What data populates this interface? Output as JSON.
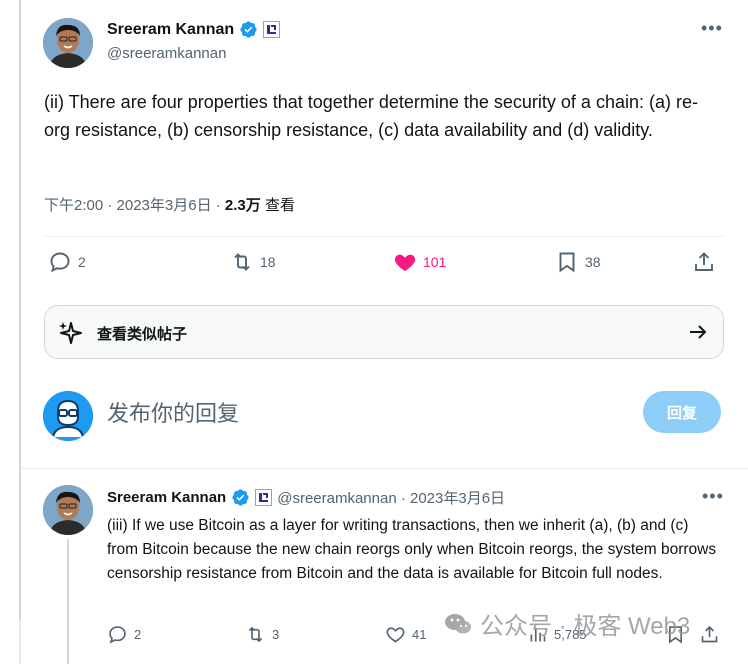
{
  "main_tweet": {
    "author_name": "Sreeram Kannan",
    "handle": "@sreeramkannan",
    "text": "(ii) There are four properties that together determine the security of a chain: (a) re-org resistance, (b) censorship resistance, (c) data availability and (d) validity.",
    "time": "下午2:00 · 2023年3月6日 · ",
    "views": "2.3万",
    "views_label": " 查看",
    "replies": "2",
    "retweets": "18",
    "likes": "101",
    "bookmarks": "38"
  },
  "similar_posts": {
    "label": "查看类似帖子"
  },
  "reply_box": {
    "placeholder": "发布你的回复",
    "button": "回复"
  },
  "second_tweet": {
    "author_name": "Sreeram Kannan",
    "handle_date": "@sreeramkannan · 2023年3月6日",
    "text": "(iii) If we use Bitcoin as a layer for writing transactions, then we inherit (a), (b) and (c) from Bitcoin because the new chain reorgs only when Bitcoin reorgs, the system borrows censorship resistance from Bitcoin and the data is available for Bitcoin full nodes.",
    "replies": "2",
    "retweets": "3",
    "likes": "41",
    "views": "5,785"
  },
  "watermark": {
    "text": "公众号 · 极客 Web3"
  },
  "colors": {
    "accent": "#1d9bf0",
    "like": "#f91880",
    "muted": "#536471"
  },
  "icons": [
    "verified-badge-icon",
    "affiliate-badge-icon",
    "more-icon",
    "reply-icon",
    "retweet-icon",
    "heart-icon",
    "bookmark-icon",
    "share-icon",
    "sparkle-icon",
    "arrow-right-icon",
    "views-icon",
    "wechat-icon"
  ]
}
